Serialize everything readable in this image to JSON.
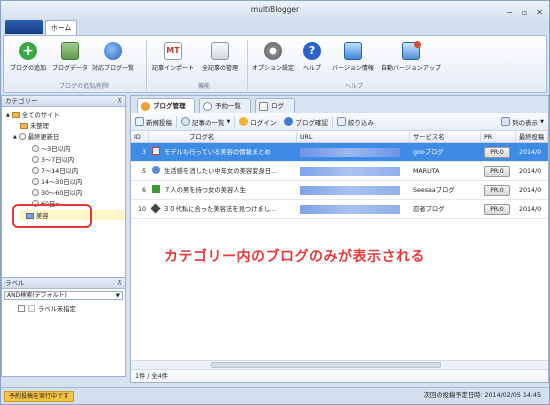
{
  "window": {
    "title": "multiBlogger",
    "controls": [
      "−",
      "▫",
      "✕"
    ]
  },
  "ribbon": {
    "tab_home": "ホーム",
    "buttons": [
      {
        "label": "ブログの追加",
        "icon": "add-icon",
        "color": "#3aa845"
      },
      {
        "label": "ブログデータ",
        "icon": "blog-data-icon",
        "color": "#6a9b5a"
      },
      {
        "label": "対応ブログ一覧",
        "icon": "globe-icon",
        "color": "#3d7bd6"
      },
      {
        "label": "記事インポート",
        "icon": "mt-import-icon",
        "color": "#c53a30"
      },
      {
        "label": "全記事の管理",
        "icon": "article-manage-icon",
        "color": "#7d8a9c"
      },
      {
        "label": "オプション設定",
        "icon": "gear-icon",
        "color": "#7b7b7b"
      },
      {
        "label": "ヘルプ",
        "icon": "help-icon",
        "color": "#2b63c8"
      },
      {
        "label": "バージョン情報",
        "icon": "monitor-check-icon",
        "color": "#3c87d8"
      },
      {
        "label": "自動バージョンアップ",
        "icon": "monitor-update-icon",
        "color": "#d94a3a"
      }
    ],
    "groups": [
      "ブログの追加/削除",
      "機能",
      "ヘルプ"
    ]
  },
  "sidebar": {
    "category_header": "カテゴリー",
    "tree": [
      {
        "label": "全てのサイト",
        "level": 0
      },
      {
        "label": "未整理",
        "level": 1
      },
      {
        "label": "最終更新日",
        "level": 1
      },
      {
        "label": "～3日以内",
        "level": 2
      },
      {
        "label": "3～7日以内",
        "level": 2
      },
      {
        "label": "7～14日以内",
        "level": 2
      },
      {
        "label": "14～30日以内",
        "level": 2
      },
      {
        "label": "30～60日以内",
        "level": 2
      },
      {
        "label": "60日～",
        "level": 2
      },
      {
        "label": "美容",
        "level": 1
      }
    ],
    "label_header": "ラベル",
    "label_combo": "AND検索(デフォルト)",
    "label_items": [
      "ラベル未指定"
    ]
  },
  "main": {
    "tabs": [
      "ブログ管理",
      "予約一覧",
      "ログ"
    ],
    "toolbar": [
      "新規投稿",
      "記事の一覧",
      "ログイン",
      "ブログ確認",
      "絞り込み",
      "列の表示"
    ],
    "columns": [
      "ID",
      "ブログ名",
      "URL",
      "サービス名",
      "PR",
      "最終投稿"
    ],
    "rows": [
      {
        "id": "3",
        "name": "モデルも行っている美容の情報まとめ",
        "service": "gooブログ",
        "pr": "PR:0",
        "date": "2014/0",
        "icon_color": "#d33"
      },
      {
        "id": "5",
        "name": "生活感を消したい中年女の美容変身日...",
        "service": "MARUTA",
        "pr": "PR:0",
        "date": "2014/0",
        "icon_color": "#5b8ad6"
      },
      {
        "id": "6",
        "name": "７人の男を持つ女の美容人生",
        "service": "Seesaaブログ",
        "pr": "PR:0",
        "date": "2014/0",
        "icon_color": "#3a9a3a"
      },
      {
        "id": "10",
        "name": "３０代私に合った美容法を見つけまし...",
        "service": "忍者ブログ",
        "pr": "PR:0",
        "date": "2014/0",
        "icon_color": "#444"
      }
    ],
    "footer": "1件 / 全4件",
    "annotation": "カテゴリー内のブログのみが表示される"
  },
  "status": {
    "left": "予約投稿を実行中です",
    "right": "次回の投稿予定日時: 2014/02/05 14:45"
  }
}
